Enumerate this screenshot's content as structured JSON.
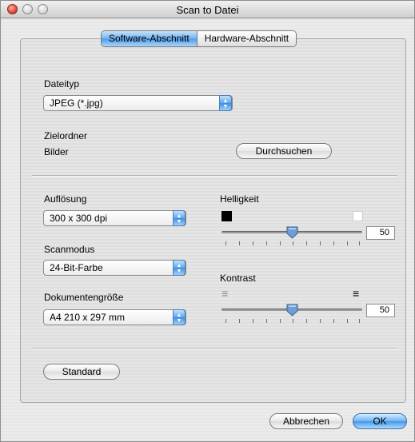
{
  "window": {
    "title": "Scan to Datei"
  },
  "tabs": [
    {
      "label": "Software-Abschnitt",
      "selected": true
    },
    {
      "label": "Hardware-Abschnitt",
      "selected": false
    }
  ],
  "file_type": {
    "label": "Dateityp",
    "value": "JPEG (*.jpg)"
  },
  "destination": {
    "label": "Zielordner",
    "folder": "Bilder",
    "browse_label": "Durchsuchen"
  },
  "resolution": {
    "label": "Auflösung",
    "value": "300 x 300 dpi"
  },
  "scan_mode": {
    "label": "Scanmodus",
    "value": "24-Bit-Farbe"
  },
  "document_size": {
    "label": "Dokumentengröße",
    "value": "A4 210 x 297 mm"
  },
  "brightness": {
    "label": "Helligkeit",
    "value": "50",
    "level": 0.5
  },
  "contrast": {
    "label": "Kontrast",
    "value": "50",
    "level": 0.5
  },
  "standard_label": "Standard",
  "cancel_label": "Abbrechen",
  "ok_label": "OK",
  "colors": {
    "accent": "#5aa6ef",
    "thumb": "#6e9fd8"
  }
}
